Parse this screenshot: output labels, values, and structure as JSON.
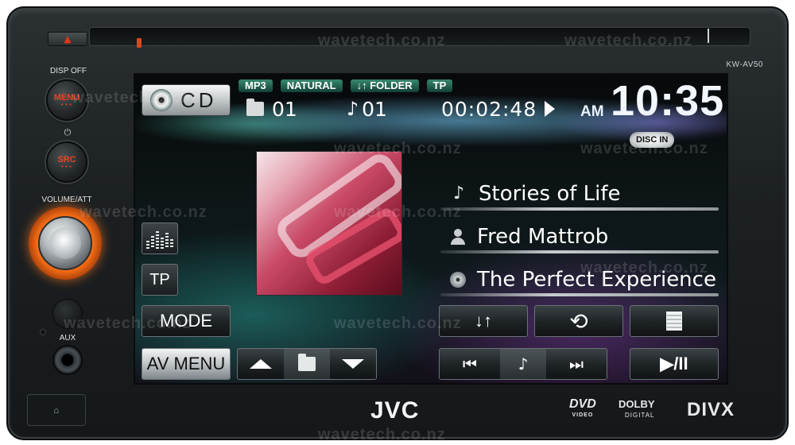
{
  "device": {
    "model": "KW-AV50",
    "brand": "JVC",
    "hw_labels": {
      "disp_off": "DISP OFF",
      "volume_att": "VOLUME/ATT",
      "aux": "AUX"
    },
    "menu_label": "MENU",
    "src_label": "SRC",
    "logos": {
      "dvd": "DVD",
      "dvd_sub": "VIDEO",
      "dolby": "DOLBY",
      "dolby_sub": "DIGITAL",
      "divx": "DIVX"
    },
    "watermark": "wavetech.co.nz"
  },
  "screen": {
    "source_label": "CD",
    "tags": [
      "MP3",
      "NATURAL",
      "↓↑ FOLDER",
      "TP"
    ],
    "folder_number": "01",
    "track_number": "01",
    "elapsed_time": "00:02:48",
    "ampm": "AM",
    "clock": "10:35",
    "disc_badge": "DISC IN",
    "track_info": {
      "title": "Stories of Life",
      "artist": "Fred Mattrob",
      "album": "The Perfect Experience"
    },
    "side_buttons": {
      "tp": "TP",
      "mode": "MODE",
      "av_menu": "AV MENU"
    },
    "icons": {
      "note": "♪",
      "random": "↓↑",
      "repeat": "⟲",
      "prev": "⏮",
      "next": "⏭",
      "play_pause": "▶/II"
    }
  }
}
